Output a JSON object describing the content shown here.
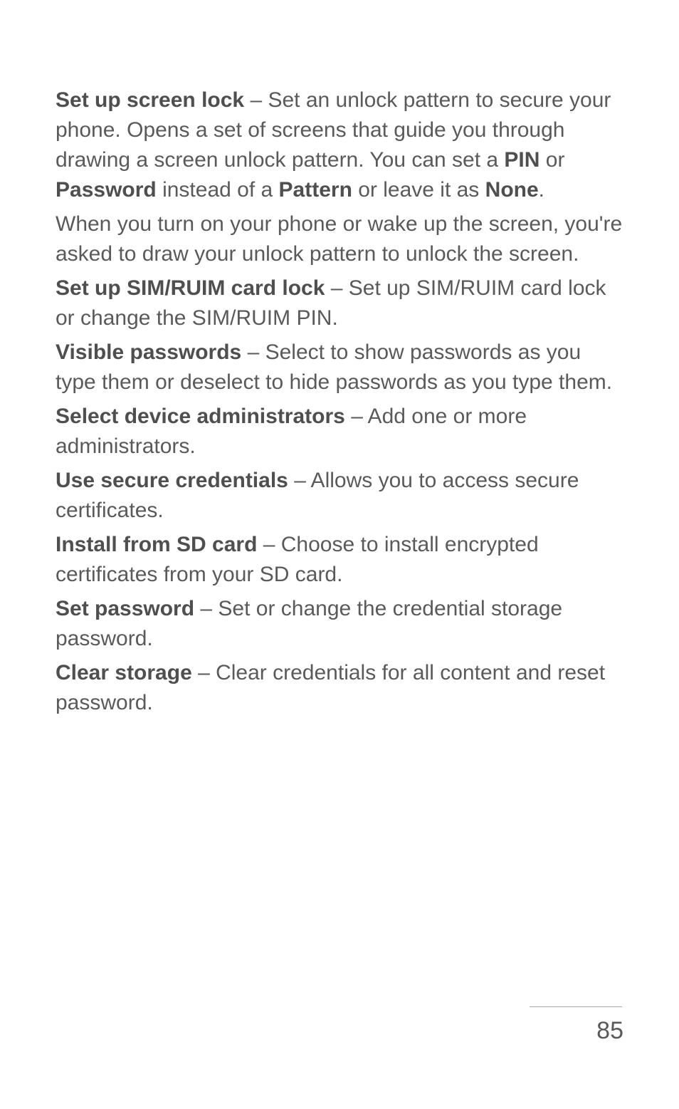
{
  "p1": {
    "b1": "Set up screen lock",
    "t1": " – Set an unlock pattern to secure your phone. Opens a set of screens that guide you through drawing a screen unlock pattern. You can set a ",
    "b2": "PIN",
    "t2": " or ",
    "b3": "Password",
    "t3": " instead of a ",
    "b4": "Pattern",
    "t4": " or leave it as ",
    "b5": "None",
    "t5": "."
  },
  "p2": "When you turn on your phone or wake up the screen, you're asked to draw your unlock pattern to unlock the screen.",
  "p3": {
    "b1": "Set up SIM/RUIM card lock",
    "t1": " – Set up SIM/RUIM card lock or change the SIM/RUIM PIN."
  },
  "p4": {
    "b1": "Visible passwords",
    "t1": " – Select to show passwords as you type them or deselect to hide passwords as you type them."
  },
  "p5": {
    "b1": "Select device administrators",
    "t1": " – Add one or more administrators."
  },
  "p6": {
    "b1": "Use secure credentials",
    "t1": " – Allows you to access secure certificates."
  },
  "p7": {
    "b1": "Install from SD card",
    "t1": " – Choose to install encrypted certificates from your SD card."
  },
  "p8": {
    "b1": "Set password",
    "t1": " – Set or change the credential storage password."
  },
  "p9": {
    "b1": "Clear storage",
    "t1": " – Clear credentials for all content and reset password."
  },
  "page_number": "85"
}
